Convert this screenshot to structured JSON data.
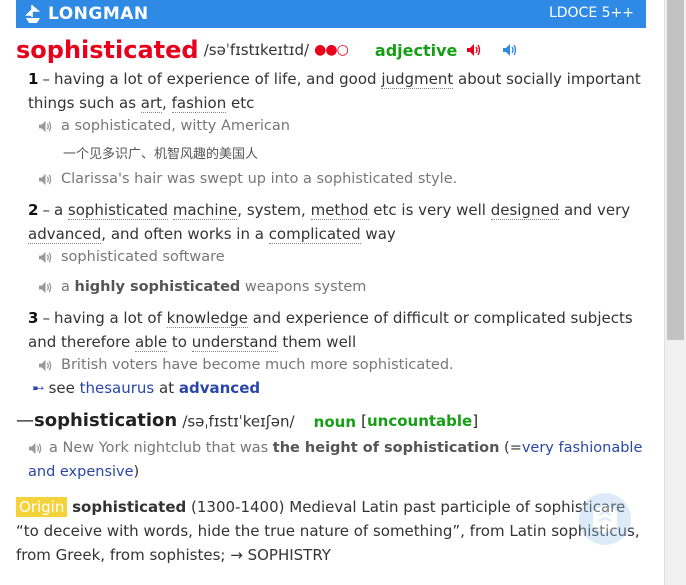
{
  "header": {
    "brand": "LONGMAN",
    "edition": "LDOCE 5++"
  },
  "entry": {
    "headword": "sophisticated",
    "pron": "/səˈfɪstɪkeɪtɪd/",
    "freq": "●●○",
    "pos": "adjective"
  },
  "senses": [
    {
      "num": "1",
      "def_parts": [
        "having a lot of experience of life, and good ",
        "judgment",
        " about socially important things such as ",
        "art",
        ", ",
        "fashion",
        " etc"
      ],
      "examples": [
        {
          "text": "a sophisticated, witty American",
          "zh": "一个见多识广、机智风趣的美国人"
        },
        {
          "text": "Clarissa's hair was swept up into a sophisticated style."
        }
      ]
    },
    {
      "num": "2",
      "def_parts": [
        "a ",
        "sophisticated",
        " ",
        "machine",
        ", system, ",
        "method",
        " etc is very well ",
        "designed",
        " and very ",
        "advanced",
        ", and often works in a ",
        "complicated",
        " way"
      ],
      "examples": [
        {
          "text": "sophisticated software"
        },
        {
          "pre": "a ",
          "strong": "highly sophisticated",
          "post": " weapons system"
        }
      ]
    },
    {
      "num": "3",
      "def_parts": [
        "having a lot of ",
        "knowledge",
        " and experience of difficult or complicated subjects and therefore ",
        "able",
        " to ",
        "understand",
        " them well"
      ],
      "examples": [
        {
          "text": "British voters have become much more sophisticated."
        }
      ]
    }
  ],
  "see_also": {
    "pre": "see ",
    "thesaurus": "thesaurus",
    "at": " at ",
    "target": "advanced"
  },
  "runon": {
    "dash": "—",
    "word": "sophistication",
    "pron": "/səˌfɪstɪˈkeɪʃən/",
    "pos": "noun",
    "gram_open": "[",
    "gram": "uncountable",
    "gram_close": "]",
    "example": {
      "pre": "a New York nightclub that was ",
      "strong": "the height of sophistication",
      "paren_open": " (=",
      "gloss": "very fashionable and expensive",
      "paren_close": ")"
    }
  },
  "origin": {
    "label": "Origin",
    "word": "sophisticated",
    "text": " (1300-1400) Medieval Latin past participle of sophisticare “to deceive with words, hide the true nature of something”, from Latin sophisticus, from Greek, from sophistes; → SOPHISTRY"
  },
  "colors": {
    "header": "#2f8ae5",
    "headword": "#e8001c",
    "pos": "#169f16",
    "link": "#2a47a8",
    "origin": "#f3d23a"
  },
  "icons": [
    "ship-logo-icon",
    "speaker-icon",
    "speaker-blue-icon",
    "arrow-icon",
    "watermark-logo-icon"
  ]
}
